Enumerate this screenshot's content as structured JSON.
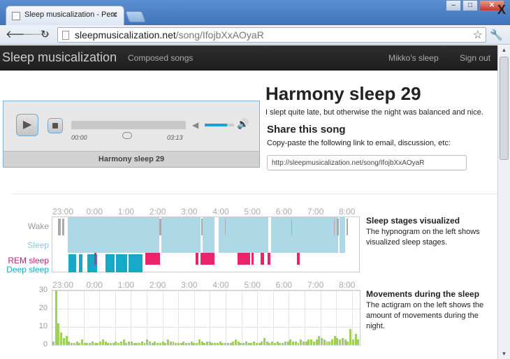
{
  "browser": {
    "tab_title": "Sleep musicalization - Perc",
    "url_domain": "sleepmusicalization.net",
    "url_path": "/song/IfojbXxAOyaR",
    "win_minimize": "–",
    "win_maximize": "□",
    "win_close": "✕",
    "overlay_x": "X"
  },
  "nav": {
    "brand": "Sleep musicalization",
    "composed_songs": "Composed songs",
    "my_sleep": "Mikko's sleep",
    "sign_out": "Sign out"
  },
  "player": {
    "time_current": "00:00",
    "time_total": "03:13",
    "volume_level": 0.75,
    "progress_level": 0.0,
    "title": "Harmony sleep 29"
  },
  "song": {
    "title": "Harmony sleep 29",
    "description": "I slept quite late, but otherwise the night was balanced and nice.",
    "share_title": "Share this song",
    "share_desc": "Copy-paste the following link to email, discussion, etc:",
    "share_link": "http://sleepmusicalization.net/song/IfojbXxAOyaR"
  },
  "hypnogram": {
    "hours": [
      "23:00",
      "0:00",
      "1:00",
      "2:00",
      "3:00",
      "4:00",
      "5:00",
      "6:00",
      "7:00",
      "8:00"
    ],
    "stages": {
      "wake": "Wake",
      "sleep": "Sleep",
      "rem": "REM sleep",
      "deep": "Deep sleep"
    },
    "colors": {
      "wake": "#aaaaaa",
      "sleep": "#add8e6",
      "rem": "#e8246a",
      "deep": "#17a9c8",
      "wake_label": "#999999",
      "sleep_label": "#8cc7e0",
      "rem_label": "#c21e74",
      "deep_label": "#18a8c4"
    },
    "side_title": "Sleep stages visualized",
    "side_desc": "The hypnogram on the left shows visualized sleep stages."
  },
  "actigram": {
    "hours": [
      "23:00",
      "0:00",
      "1:00",
      "2:00",
      "3:00",
      "4:00",
      "5:00",
      "6:00",
      "7:00",
      "8:00"
    ],
    "y_ticks": [
      "30",
      "20",
      "10",
      "0"
    ],
    "y_max": 30,
    "bar_color": "#9fd15a",
    "movements": [
      2,
      30,
      12,
      7,
      4,
      5,
      2,
      1,
      1,
      2,
      1,
      3,
      1,
      1,
      1,
      2,
      1,
      1,
      2,
      3,
      2,
      1,
      1,
      1,
      2,
      1,
      2,
      3,
      1,
      2,
      2,
      1,
      1,
      1,
      2,
      1,
      3,
      2,
      1,
      2,
      1,
      1,
      2,
      1,
      3,
      2,
      2,
      1,
      1,
      1,
      2,
      1,
      1,
      2,
      1,
      1,
      3,
      2,
      1,
      2,
      2,
      1,
      1,
      1,
      2,
      1,
      1,
      1,
      1,
      2,
      3,
      2,
      1,
      1,
      2,
      1,
      1,
      2,
      1,
      1,
      2,
      4,
      2,
      1,
      2,
      1,
      2,
      1,
      1,
      2,
      2,
      3,
      2,
      2,
      1,
      3,
      2,
      2,
      3,
      3,
      2,
      3,
      5,
      4,
      3,
      2,
      2,
      3,
      5,
      4,
      3,
      4,
      3,
      2,
      9,
      3,
      6,
      3
    ],
    "side_title": "Movements during the sleep",
    "side_desc": "The actigram on the left shows the amount of movements during the night."
  }
}
